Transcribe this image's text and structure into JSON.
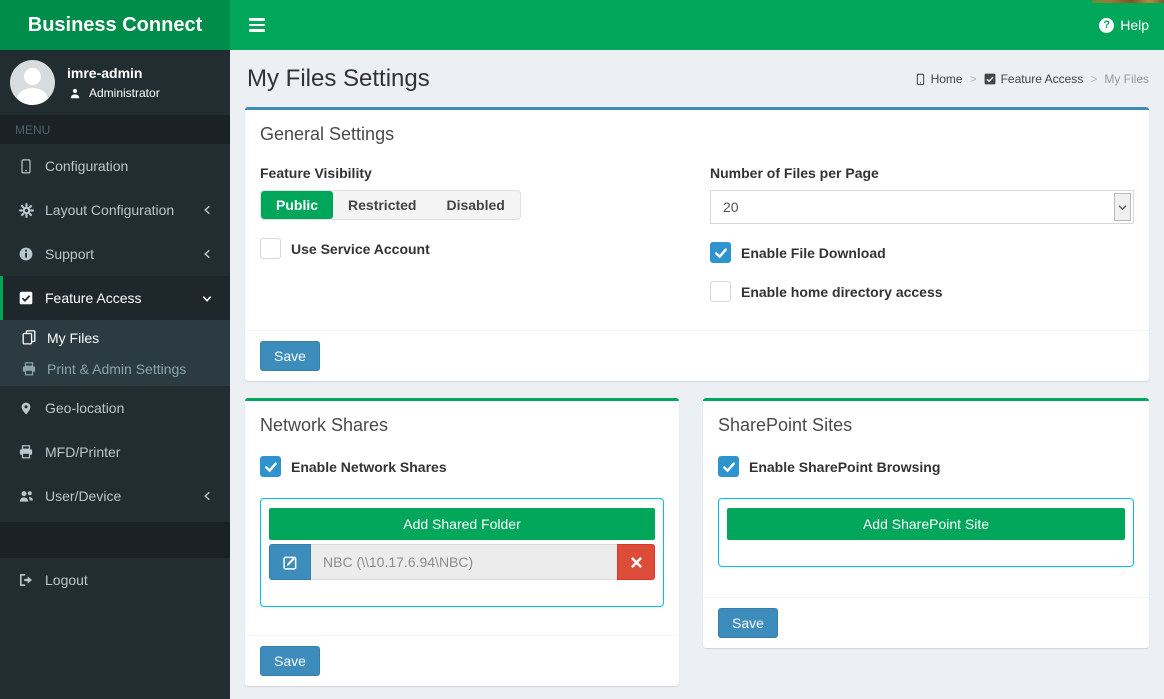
{
  "topbar": {
    "brand": "Business Connect",
    "help_label": "Help"
  },
  "user_panel": {
    "name": "imre-admin",
    "role": "Administrator"
  },
  "sidebar": {
    "menu_header": "MENU",
    "items": [
      {
        "label": "Configuration"
      },
      {
        "label": "Layout Configuration"
      },
      {
        "label": "Support"
      },
      {
        "label": "Feature Access"
      },
      {
        "label": "Geo-location"
      },
      {
        "label": "MFD/Printer"
      },
      {
        "label": "User/Device"
      },
      {
        "label": "Logout"
      }
    ],
    "feature_access_submenu": [
      {
        "label": "My Files",
        "active": true
      },
      {
        "label": "Print & Admin Settings",
        "active": false
      }
    ]
  },
  "page": {
    "title": "My Files Settings",
    "breadcrumb": {
      "home": "Home",
      "section": "Feature Access",
      "current": "My Files"
    }
  },
  "general_settings": {
    "title": "General Settings",
    "feature_visibility": {
      "label": "Feature Visibility",
      "options": [
        "Public",
        "Restricted",
        "Disabled"
      ],
      "selected": "Public"
    },
    "use_service_account": {
      "label": "Use Service Account",
      "checked": false
    },
    "files_per_page": {
      "label": "Number of Files per Page",
      "value": "20"
    },
    "enable_file_download": {
      "label": "Enable File Download",
      "checked": true
    },
    "enable_home_directory": {
      "label": "Enable home directory access",
      "checked": false
    },
    "save_label": "Save"
  },
  "network_shares": {
    "title": "Network Shares",
    "enable": {
      "label": "Enable Network Shares",
      "checked": true
    },
    "add_button_label": "Add Shared Folder",
    "shares": [
      {
        "name": "NBC (\\\\10.17.6.94\\NBC)"
      }
    ],
    "save_label": "Save"
  },
  "sharepoint_sites": {
    "title": "SharePoint Sites",
    "enable": {
      "label": "Enable SharePoint Browsing",
      "checked": true
    },
    "add_button_label": "Add SharePoint Site",
    "save_label": "Save"
  },
  "colors": {
    "navbar_green": "#00a65a",
    "logo_green": "#008d4c",
    "sidebar_dark": "#222d32",
    "content_background": "#ecf0f5",
    "primary_blue": "#3c8dbc",
    "checkbox_blue": "#2e93cf",
    "danger_red": "#dd4b39",
    "share_box_border": "#00c0ef"
  }
}
